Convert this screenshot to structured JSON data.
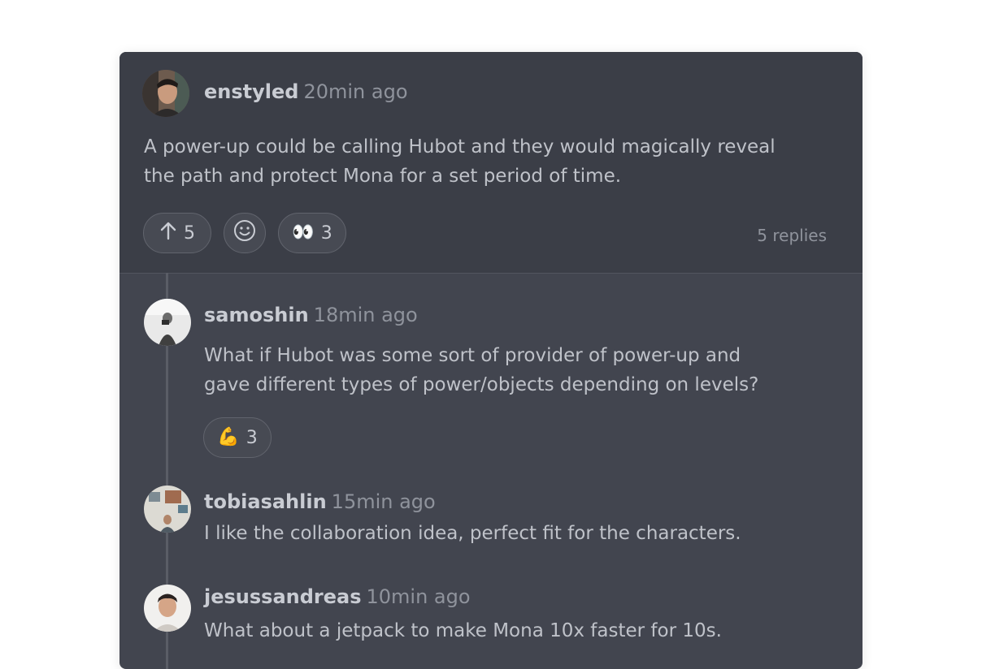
{
  "post": {
    "author": "enstyled",
    "time": "20min ago",
    "body_line1": "A power-up could be calling Hubot and they would magically reveal",
    "body_line2": "the path and protect Mona for a set period of time.",
    "reactions": {
      "upvote_count": "5",
      "eyes_emoji": "👀",
      "eyes_count": "3"
    },
    "replies_label": "5 replies"
  },
  "replies": [
    {
      "author": "samoshin",
      "time": "18min ago",
      "body_line1": "What if Hubot was some sort of provider of power-up and",
      "body_line2": "gave different types of power/objects depending on levels?",
      "reaction_emoji": "💪",
      "reaction_count": "3"
    },
    {
      "author": "tobiasahlin",
      "time": "15min ago",
      "body_line1": "I like the collaboration idea, perfect fit for the characters."
    },
    {
      "author": "jesussandreas",
      "time": "10min ago",
      "body_line1": "What about a jetpack to make Mona 10x faster for 10s."
    }
  ],
  "colors": {
    "page_background": "#ffffff",
    "card_background": "#42454f",
    "main_post_background": "#3b3e47",
    "author_text": "#c9ccd3",
    "muted_text": "#8f939c"
  },
  "icons": {
    "upvote": "arrow-up-icon",
    "add_reaction": "smiley-icon"
  }
}
